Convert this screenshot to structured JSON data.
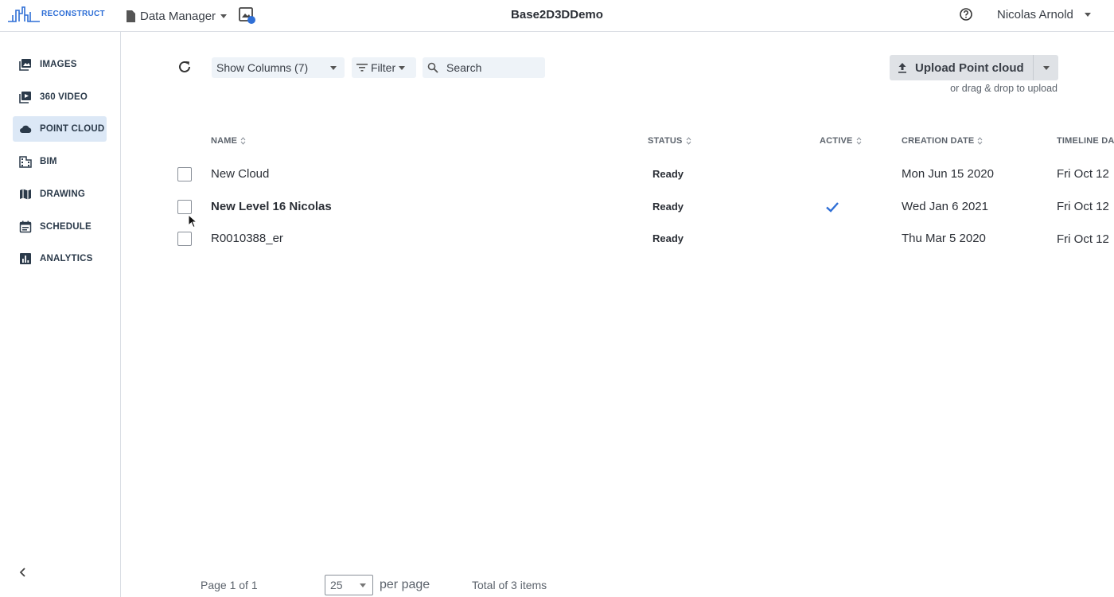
{
  "app": {
    "logo_text": "RECONSTRUCT",
    "section_menu": "Data Manager",
    "project_title": "Base2D3DDemo",
    "user_name": "Nicolas Arnold"
  },
  "sidebar": {
    "items": [
      {
        "label": "IMAGES",
        "icon": "image-icon",
        "active": false
      },
      {
        "label": "360 VIDEO",
        "icon": "video-icon",
        "active": false
      },
      {
        "label": "POINT CLOUD",
        "icon": "cloud-icon",
        "active": true
      },
      {
        "label": "BIM",
        "icon": "building-icon",
        "active": false
      },
      {
        "label": "DRAWING",
        "icon": "map-icon",
        "active": false
      },
      {
        "label": "SCHEDULE",
        "icon": "calendar-icon",
        "active": false
      },
      {
        "label": "ANALYTICS",
        "icon": "bar-chart-icon",
        "active": false
      }
    ]
  },
  "toolbar": {
    "show_columns": "Show Columns (7)",
    "filter": "Filter",
    "search_placeholder": "Search",
    "upload_label": "Upload Point cloud",
    "drag_hint": "or drag & drop to upload"
  },
  "table": {
    "columns": [
      "NAME",
      "STATUS",
      "ACTIVE",
      "CREATION DATE",
      "TIMELINE DA"
    ],
    "rows": [
      {
        "name": "New Cloud",
        "status": "Ready",
        "active": false,
        "creation_date": "Mon Jun 15 2020",
        "timeline_date": "Fri Oct 12",
        "bold": false
      },
      {
        "name": "New Level 16 Nicolas",
        "status": "Ready",
        "active": true,
        "creation_date": "Wed Jan 6 2021",
        "timeline_date": "Fri Oct 12",
        "bold": true
      },
      {
        "name": "R0010388_er",
        "status": "Ready",
        "active": false,
        "creation_date": "Thu Mar 5 2020",
        "timeline_date": "Fri Oct 12",
        "bold": false
      }
    ]
  },
  "pagination": {
    "page_info": "Page 1 of 1",
    "per_page_value": "25",
    "per_page_label": "per page",
    "total": "Total of 3 items"
  },
  "colors": {
    "accent": "#2f6fd6",
    "active_nav_bg": "#dce8f6",
    "check": "#2f6fd6"
  }
}
